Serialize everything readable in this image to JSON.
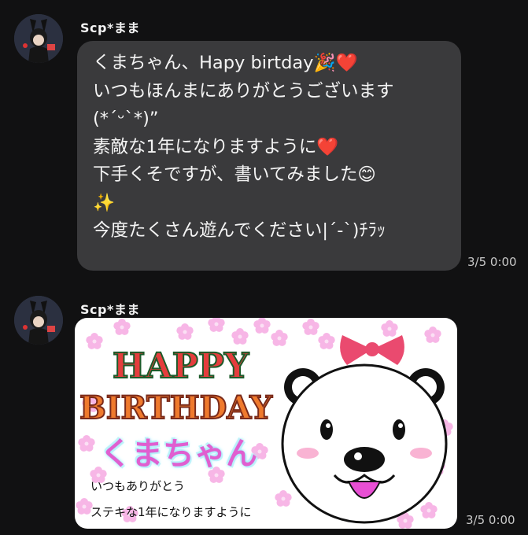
{
  "messages": [
    {
      "sender": "Scp*まま",
      "lines": [
        "くまちゃん、Hapy birtday🎉❤️",
        "いつもほんまにありがとうございます",
        "(*ˊᵕˋ*)”",
        "素敵な1年になりますように❤️",
        "下手くそですが、書いてみました😊",
        "✨",
        "今度たくさん遊んでください|ˊ-ˋ)ﾁﾗｯ"
      ],
      "time": "3/5 0:00"
    },
    {
      "sender": "Scp*まま",
      "image": {
        "happy": "HAPPY",
        "birthday": "BIRTHDAY",
        "name": "くまちゃん",
        "line1": "いつもありがとう",
        "line2": "ステキな1年になりますように"
      },
      "time": "3/5 0:00"
    }
  ],
  "colors": {
    "background": "#111112",
    "bubble": "#3a3a3c",
    "accent_pink": "#e05fd0"
  }
}
